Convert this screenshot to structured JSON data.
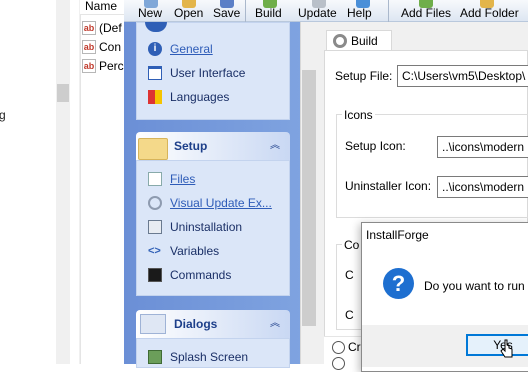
{
  "explorer": {
    "left_fragment": "g",
    "name_header": "Name",
    "files": [
      {
        "name": "(Def",
        "icon": "ab-file-icon"
      },
      {
        "name": "Con",
        "icon": "ab-file-icon"
      },
      {
        "name": "Perc",
        "icon": "ab-file-icon"
      }
    ]
  },
  "toolbar": {
    "new": "New",
    "open": "Open",
    "save": "Save",
    "build": "Build",
    "update": "Update",
    "help": "Help",
    "add_files": "Add Files",
    "add_folder": "Add Folder"
  },
  "nav": {
    "top_items": [
      {
        "label": "General",
        "icon": "info-icon",
        "link": true
      },
      {
        "label": "User Interface",
        "icon": "window-icon",
        "link": false
      },
      {
        "label": "Languages",
        "icon": "flags-icon",
        "link": false
      }
    ],
    "setup": {
      "title": "Setup",
      "items": [
        {
          "label": "Files",
          "icon": "file-add-icon",
          "link": true
        },
        {
          "label": "Visual Update Ex...",
          "icon": "update-icon",
          "link": true
        },
        {
          "label": "Uninstallation",
          "icon": "uninstall-icon",
          "link": false
        },
        {
          "label": "Variables",
          "icon": "code-icon",
          "link": false
        },
        {
          "label": "Commands",
          "icon": "terminal-icon",
          "link": false
        }
      ]
    },
    "dialogs": {
      "title": "Dialogs",
      "items": [
        {
          "label": "Splash Screen",
          "icon": "image-icon",
          "link": false
        }
      ]
    }
  },
  "content": {
    "tab": "Build",
    "setup_file_label": "Setup File:",
    "setup_file_value": "C:\\Users\\vm5\\Desktop\\",
    "icons_group": "Icons",
    "setup_icon_label": "Setup Icon:",
    "setup_icon_value": "..\\icons\\modern",
    "uninstaller_icon_label": "Uninstaller Icon:",
    "uninstaller_icon_value": "..\\icons\\modern",
    "compression_group_fragment": "Co",
    "row_fragment_1": "C",
    "row_fragment_2": "C",
    "bottom_fragment": "Cr"
  },
  "dialog": {
    "title": "InstallForge",
    "message": "Do you want to run",
    "yes": "Yes",
    "icon": "question-icon"
  },
  "colors": {
    "nav_bg": "#7497dc",
    "nav_header_text": "#1d3f8a",
    "link": "#2e5cb8",
    "dialog_accent": "#0078d7",
    "question_icon": "#1e6fd0"
  }
}
